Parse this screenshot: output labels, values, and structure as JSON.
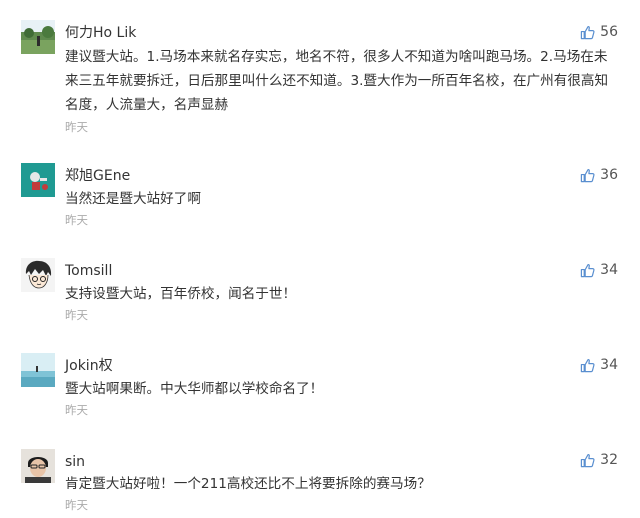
{
  "comments": [
    {
      "user": "何力Ho Lik",
      "text": "建议暨大站。1.马场本来就名存实忘，地名不符，很多人不知道为啥叫跑马场。2.马场在未来三五年就要拆迁，日后那里叫什么还不知道。3.暨大作为一所百年名校，在广州有很高知名度，人流量大，名声显赫",
      "time": "昨天",
      "likes": "56",
      "avatar_icon": "landscape-photo-avatar"
    },
    {
      "user": "郑旭GEne",
      "text": "当然还是暨大站好了啊",
      "time": "昨天",
      "likes": "36",
      "avatar_icon": "teal-figure-avatar"
    },
    {
      "user": "Tomsill",
      "text": "支持设暨大站，百年侨校，闻名于世！",
      "time": "昨天",
      "likes": "34",
      "avatar_icon": "anime-boy-avatar"
    },
    {
      "user": "Jokin权",
      "text": "暨大站啊果断。中大华师都以学校命名了！",
      "time": "昨天",
      "likes": "34",
      "avatar_icon": "seaside-photo-avatar"
    },
    {
      "user": "sin",
      "text": "肯定暨大站好啦！一个211高校还比不上将要拆除的赛马场？",
      "time": "昨天",
      "likes": "32",
      "avatar_icon": "portrait-photo-avatar"
    }
  ],
  "colors": {
    "like_icon": "#5a8fd0",
    "text": "#333333",
    "time": "#aaaaaa"
  }
}
